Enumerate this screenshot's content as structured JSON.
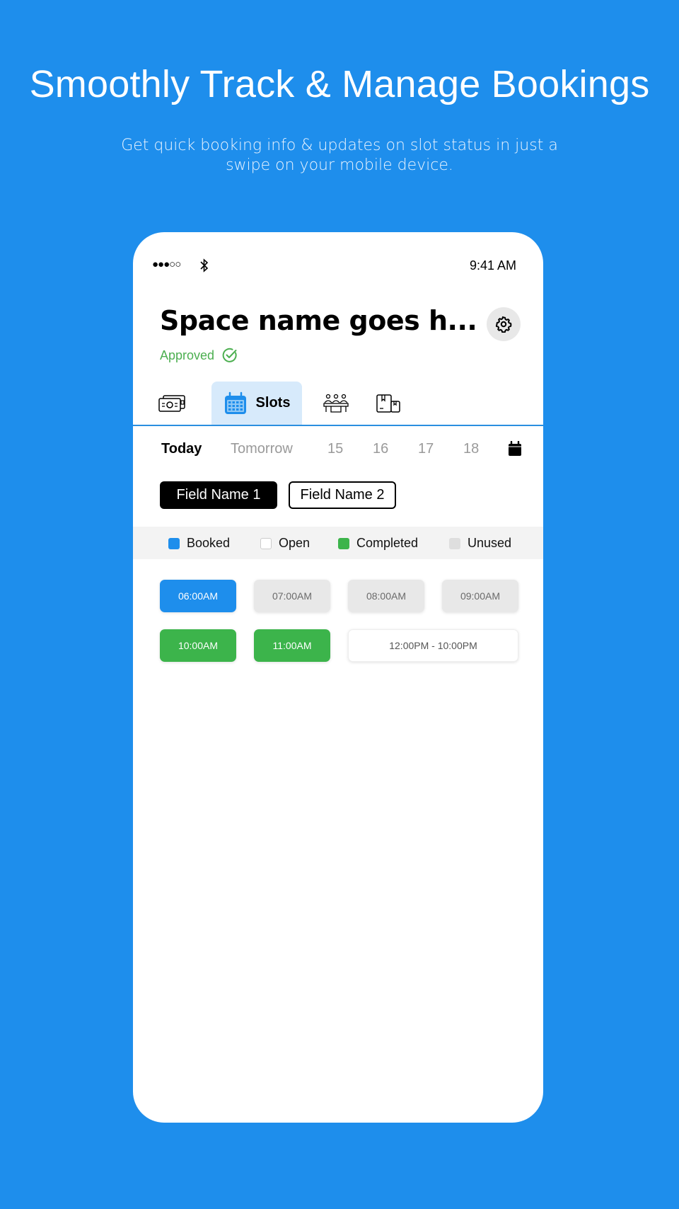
{
  "hero": {
    "title": "Smoothly Track & Manage Bookings",
    "subtitle": "Get quick booking info & updates on slot status in just a swipe on your mobile device."
  },
  "status_bar": {
    "signal": "●●●○○",
    "bluetooth_icon": "bluetooth-icon",
    "time": "9:41 AM"
  },
  "space": {
    "title": "Space name goes h...",
    "status": "Approved",
    "status_icon": "check-circle-icon",
    "settings_icon": "gear-icon"
  },
  "tabs": [
    {
      "icon": "payment-card-icon",
      "label": "",
      "active": false
    },
    {
      "icon": "calendar-icon",
      "label": "Slots",
      "active": true
    },
    {
      "icon": "meeting-people-icon",
      "label": "",
      "active": false
    },
    {
      "icon": "documents-icon",
      "label": "",
      "active": false
    }
  ],
  "dates": [
    {
      "label": "Today",
      "active": true
    },
    {
      "label": "Tomorrow",
      "active": false
    },
    {
      "label": "15",
      "active": false
    },
    {
      "label": "16",
      "active": false
    },
    {
      "label": "17",
      "active": false
    },
    {
      "label": "18",
      "active": false
    }
  ],
  "fields": [
    {
      "label": "Field Name 1",
      "active": true
    },
    {
      "label": "Field Name 2",
      "active": false
    }
  ],
  "legend": [
    {
      "label": "Booked",
      "color": "#1e8eec"
    },
    {
      "label": "Open",
      "color": "#ffffff"
    },
    {
      "label": "Completed",
      "color": "#3cb44b"
    },
    {
      "label": "Unused",
      "color": "#dedede"
    }
  ],
  "slots": [
    {
      "label": "06:00AM",
      "status": "booked"
    },
    {
      "label": "07:00AM",
      "status": "unused"
    },
    {
      "label": "08:00AM",
      "status": "unused"
    },
    {
      "label": "09:00AM",
      "status": "unused"
    },
    {
      "label": "10:00AM",
      "status": "completed"
    },
    {
      "label": "11:00AM",
      "status": "completed"
    },
    {
      "label": "12:00PM - 10:00PM",
      "status": "open"
    }
  ],
  "colors": {
    "background": "#1e8eec",
    "approved": "#4caf50",
    "tab_active_bg": "#d7eafb"
  }
}
